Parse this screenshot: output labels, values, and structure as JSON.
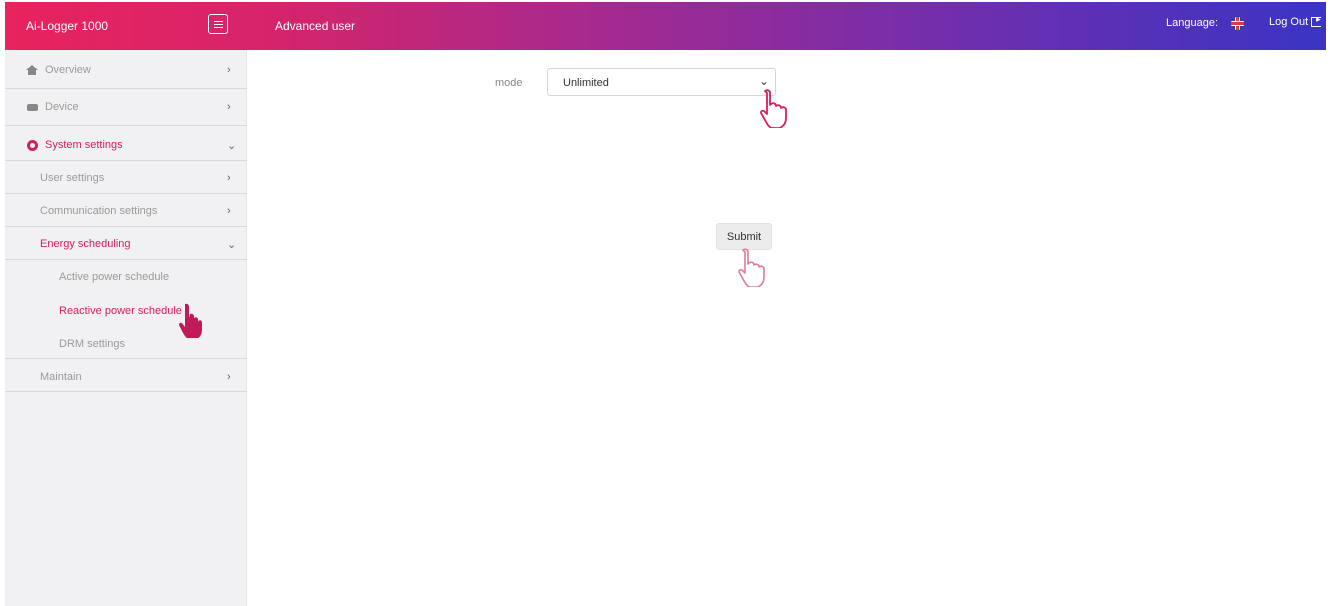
{
  "header": {
    "brand": "Ai-Logger 1000",
    "role": "Advanced user",
    "language_label": "Language:",
    "logout_label": "Log Out"
  },
  "sidebar": {
    "items": [
      {
        "label": "Overview",
        "icon": "home-icon",
        "chevron": "›"
      },
      {
        "label": "Device",
        "icon": "device-icon",
        "chevron": "›"
      },
      {
        "label": "System settings",
        "icon": "gear-icon",
        "chevron": "⌄"
      }
    ],
    "system_settings": {
      "children": [
        {
          "label": "User settings",
          "chevron": "›"
        },
        {
          "label": "Communication settings",
          "chevron": "›"
        },
        {
          "label": "Energy scheduling",
          "chevron": "⌄"
        }
      ],
      "energy_scheduling": {
        "children": [
          {
            "label": "Active power schedule"
          },
          {
            "label": "Reactive power schedule"
          },
          {
            "label": "DRM settings"
          }
        ]
      }
    },
    "maintain": {
      "label": "Maintain",
      "chevron": "›"
    }
  },
  "form": {
    "mode_label": "mode",
    "mode_value": "Unlimited",
    "submit_label": "Submit"
  },
  "colors": {
    "accent": "#d81d5d",
    "header_gradient_start": "#e8235e",
    "header_gradient_end": "#3a34c4"
  }
}
